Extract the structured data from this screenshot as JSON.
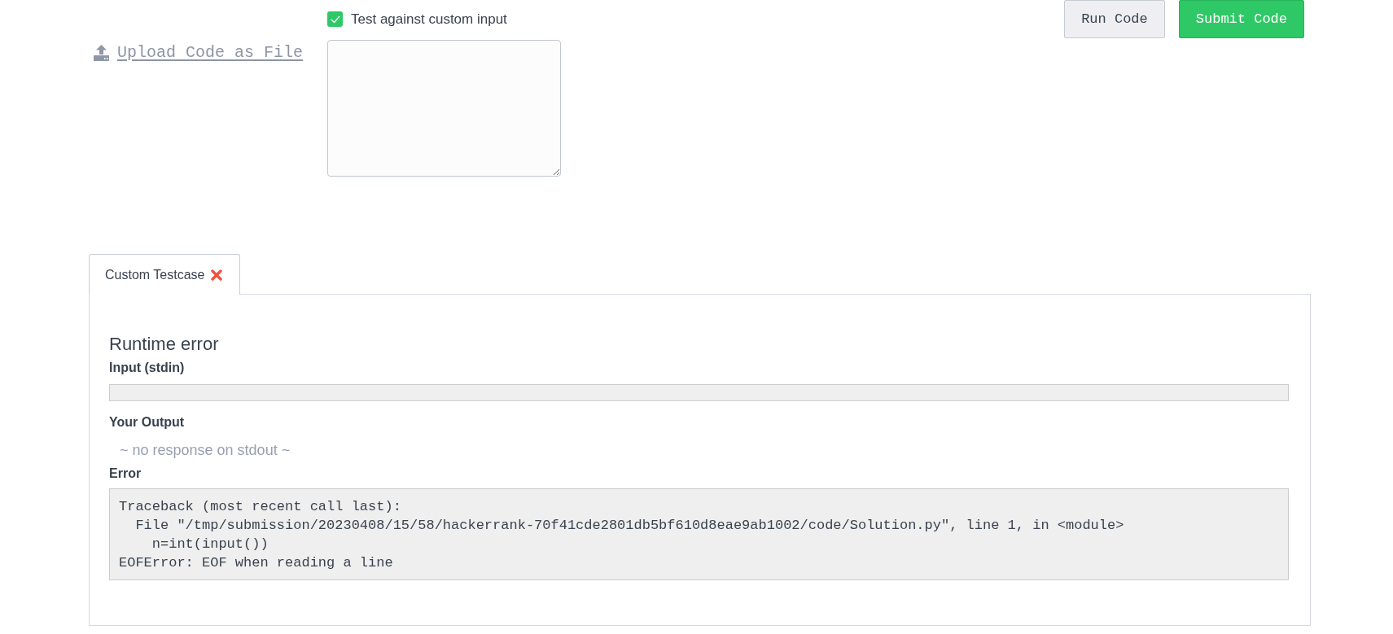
{
  "upload_link": {
    "label": "Upload Code as File"
  },
  "custom_input": {
    "label": "Test against custom input",
    "checked": true
  },
  "buttons": [
    {
      "label": "Run Code",
      "kind": "secondary"
    },
    {
      "label": "Submit Code",
      "kind": "primary"
    }
  ],
  "tabs": [
    {
      "label": "Custom Testcase",
      "selected": true,
      "passed": false
    }
  ],
  "result": {
    "title": "Runtime error",
    "sections": [
      {
        "heading": "Input (stdin)",
        "kind": "box"
      },
      {
        "heading": "Your Output",
        "kind": "message",
        "message": "~ no response on stdout ~"
      },
      {
        "heading": "Error",
        "kind": "code",
        "lines": [
          "Traceback (most recent call last):",
          "  File \"/tmp/submission/20230408/15/58/hackerrank-70f41cde2801db5bf610d8eae9ab1002/code/Solution.py\", line 1, in <module>",
          "    n=int(input())",
          "EOFError: EOF when reading a line"
        ]
      }
    ]
  }
}
